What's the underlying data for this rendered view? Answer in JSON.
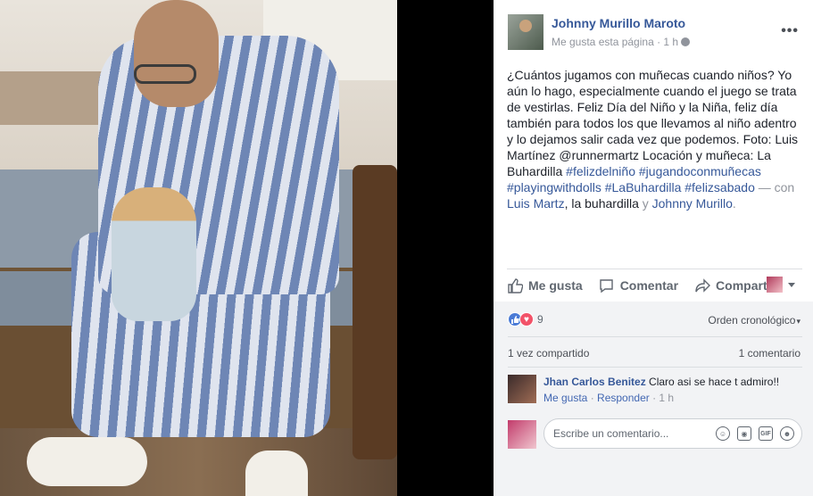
{
  "post": {
    "author": "Johnny Murillo Maroto",
    "like_page": "Me gusta esta página",
    "separator": " · ",
    "time": "1 h",
    "more": "•••",
    "text_main": "¿Cuántos jugamos con muñecas cuando niños? Yo aún lo hago, especialmente cuando el juego se trata de vestirlas. Feliz Día del Niño y la Niña, feliz día también para todos los que llevamos al niño adentro y lo dejamos salir cada vez que podemos. Foto: Luis Martínez @runnermartz Locación y muñeca: La Buhardilla ",
    "hashtags_1": "#felizdelniño #jugandoconmuñecas #playingwithdolls #LaBuhardilla #felizsabado",
    "with_label": " — con ",
    "tag_1": "Luis Martz",
    "comma": ", ",
    "tag_2_plain": "la buhardilla",
    "and_label": " y ",
    "tag_3": "Johnny Murillo",
    "period": "."
  },
  "actions": {
    "like": "Me gusta",
    "comment": "Comentar",
    "share": "Compartir"
  },
  "stats": {
    "reaction_count": "9",
    "order": "Orden cronológico",
    "shared": "1 vez compartido",
    "comments": "1 comentario"
  },
  "comment": {
    "author": "Jhan Carlos Benitez",
    "text": "Claro asi se hace t admiro!!",
    "like": "Me gusta",
    "separator": " · ",
    "reply": "Responder",
    "time": "1 h"
  },
  "composer": {
    "placeholder": "Escribe un comentario..."
  }
}
